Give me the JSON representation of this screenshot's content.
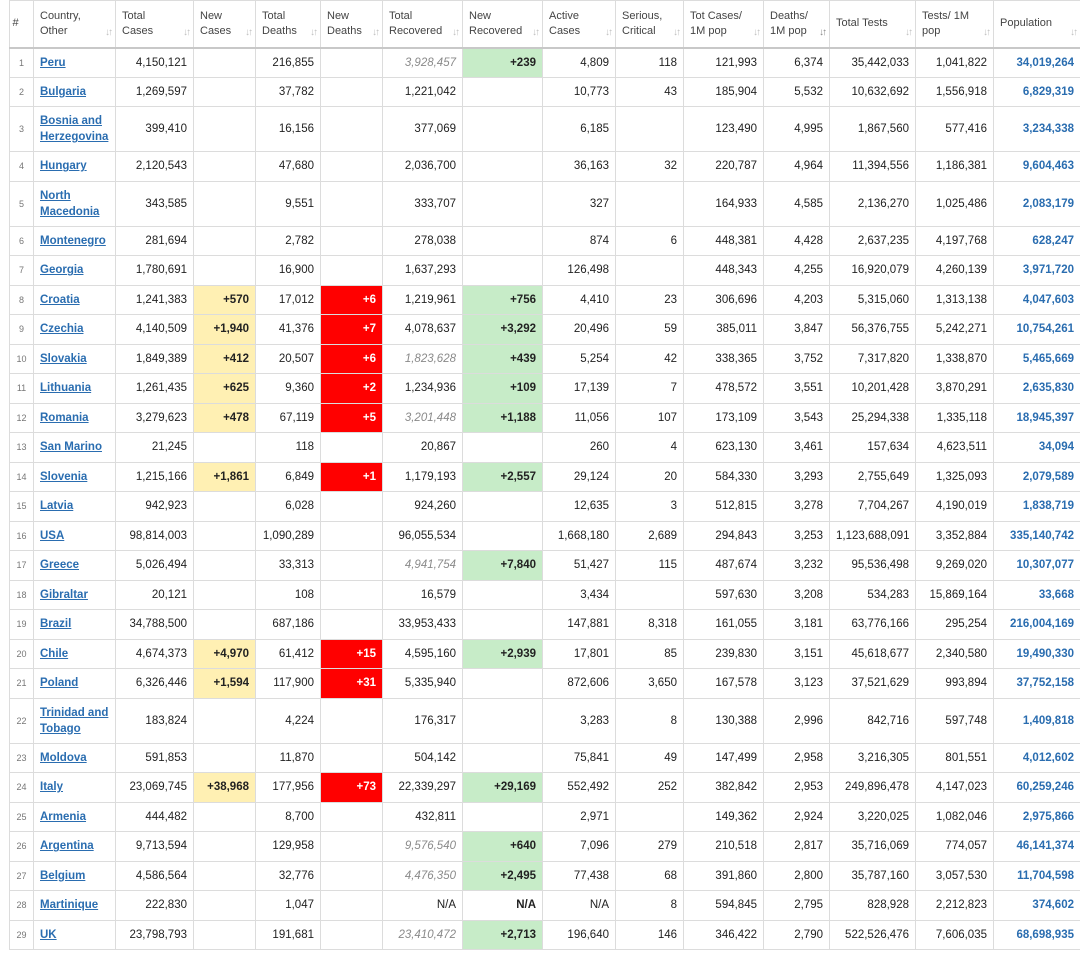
{
  "headers": [
    {
      "key": "num",
      "label": "#"
    },
    {
      "key": "country",
      "label": "Country, Other"
    },
    {
      "key": "total_cases",
      "label": "Total Cases"
    },
    {
      "key": "new_cases",
      "label": "New Cases"
    },
    {
      "key": "total_deaths",
      "label": "Total Deaths"
    },
    {
      "key": "new_deaths",
      "label": "New Deaths"
    },
    {
      "key": "total_recovered",
      "label": "Total Recovered"
    },
    {
      "key": "new_recovered",
      "label": "New Recovered"
    },
    {
      "key": "active_cases",
      "label": "Active Cases"
    },
    {
      "key": "serious_critical",
      "label": "Serious, Critical"
    },
    {
      "key": "tot_cases_1m",
      "label": "Tot Cases/ 1M pop"
    },
    {
      "key": "deaths_1m",
      "label": "Deaths/ 1M pop"
    },
    {
      "key": "total_tests",
      "label": "Total Tests"
    },
    {
      "key": "tests_1m",
      "label": "Tests/ 1M pop"
    },
    {
      "key": "population",
      "label": "Population"
    }
  ],
  "sort_icon": "sort-arrows-icon",
  "active_sort_column": "deaths_1m",
  "colors": {
    "new_cases_bg": "#fff0b3",
    "new_deaths_bg": "#ff0000",
    "new_recovered_bg": "#c7ecc8",
    "link": "#2a6db0",
    "estimated_text": "#8a8a8a"
  },
  "rows": [
    {
      "num": "1",
      "country": "Peru",
      "total_cases": "4,150,121",
      "new_cases": "",
      "total_deaths": "216,855",
      "new_deaths": "",
      "total_recovered": "3,928,457",
      "recovered_estimated": true,
      "new_recovered": "+239",
      "active_cases": "4,809",
      "serious_critical": "118",
      "tot_cases_1m": "121,993",
      "deaths_1m": "6,374",
      "total_tests": "35,442,033",
      "tests_1m": "1,041,822",
      "population": "34,019,264"
    },
    {
      "num": "2",
      "country": "Bulgaria",
      "total_cases": "1,269,597",
      "new_cases": "",
      "total_deaths": "37,782",
      "new_deaths": "",
      "total_recovered": "1,221,042",
      "recovered_estimated": false,
      "new_recovered": "",
      "active_cases": "10,773",
      "serious_critical": "43",
      "tot_cases_1m": "185,904",
      "deaths_1m": "5,532",
      "total_tests": "10,632,692",
      "tests_1m": "1,556,918",
      "population": "6,829,319"
    },
    {
      "num": "3",
      "country": "Bosnia and Herzegovina",
      "total_cases": "399,410",
      "new_cases": "",
      "total_deaths": "16,156",
      "new_deaths": "",
      "total_recovered": "377,069",
      "recovered_estimated": false,
      "new_recovered": "",
      "active_cases": "6,185",
      "serious_critical": "",
      "tot_cases_1m": "123,490",
      "deaths_1m": "4,995",
      "total_tests": "1,867,560",
      "tests_1m": "577,416",
      "population": "3,234,338"
    },
    {
      "num": "4",
      "country": "Hungary",
      "total_cases": "2,120,543",
      "new_cases": "",
      "total_deaths": "47,680",
      "new_deaths": "",
      "total_recovered": "2,036,700",
      "recovered_estimated": false,
      "new_recovered": "",
      "active_cases": "36,163",
      "serious_critical": "32",
      "tot_cases_1m": "220,787",
      "deaths_1m": "4,964",
      "total_tests": "11,394,556",
      "tests_1m": "1,186,381",
      "population": "9,604,463"
    },
    {
      "num": "5",
      "country": "North Macedonia",
      "total_cases": "343,585",
      "new_cases": "",
      "total_deaths": "9,551",
      "new_deaths": "",
      "total_recovered": "333,707",
      "recovered_estimated": false,
      "new_recovered": "",
      "active_cases": "327",
      "serious_critical": "",
      "tot_cases_1m": "164,933",
      "deaths_1m": "4,585",
      "total_tests": "2,136,270",
      "tests_1m": "1,025,486",
      "population": "2,083,179"
    },
    {
      "num": "6",
      "country": "Montenegro",
      "total_cases": "281,694",
      "new_cases": "",
      "total_deaths": "2,782",
      "new_deaths": "",
      "total_recovered": "278,038",
      "recovered_estimated": false,
      "new_recovered": "",
      "active_cases": "874",
      "serious_critical": "6",
      "tot_cases_1m": "448,381",
      "deaths_1m": "4,428",
      "total_tests": "2,637,235",
      "tests_1m": "4,197,768",
      "population": "628,247"
    },
    {
      "num": "7",
      "country": "Georgia",
      "total_cases": "1,780,691",
      "new_cases": "",
      "total_deaths": "16,900",
      "new_deaths": "",
      "total_recovered": "1,637,293",
      "recovered_estimated": false,
      "new_recovered": "",
      "active_cases": "126,498",
      "serious_critical": "",
      "tot_cases_1m": "448,343",
      "deaths_1m": "4,255",
      "total_tests": "16,920,079",
      "tests_1m": "4,260,139",
      "population": "3,971,720"
    },
    {
      "num": "8",
      "country": "Croatia",
      "total_cases": "1,241,383",
      "new_cases": "+570",
      "total_deaths": "17,012",
      "new_deaths": "+6",
      "total_recovered": "1,219,961",
      "recovered_estimated": false,
      "new_recovered": "+756",
      "active_cases": "4,410",
      "serious_critical": "23",
      "tot_cases_1m": "306,696",
      "deaths_1m": "4,203",
      "total_tests": "5,315,060",
      "tests_1m": "1,313,138",
      "population": "4,047,603"
    },
    {
      "num": "9",
      "country": "Czechia",
      "total_cases": "4,140,509",
      "new_cases": "+1,940",
      "total_deaths": "41,376",
      "new_deaths": "+7",
      "total_recovered": "4,078,637",
      "recovered_estimated": false,
      "new_recovered": "+3,292",
      "active_cases": "20,496",
      "serious_critical": "59",
      "tot_cases_1m": "385,011",
      "deaths_1m": "3,847",
      "total_tests": "56,376,755",
      "tests_1m": "5,242,271",
      "population": "10,754,261"
    },
    {
      "num": "10",
      "country": "Slovakia",
      "total_cases": "1,849,389",
      "new_cases": "+412",
      "total_deaths": "20,507",
      "new_deaths": "+6",
      "total_recovered": "1,823,628",
      "recovered_estimated": true,
      "new_recovered": "+439",
      "active_cases": "5,254",
      "serious_critical": "42",
      "tot_cases_1m": "338,365",
      "deaths_1m": "3,752",
      "total_tests": "7,317,820",
      "tests_1m": "1,338,870",
      "population": "5,465,669"
    },
    {
      "num": "11",
      "country": "Lithuania",
      "total_cases": "1,261,435",
      "new_cases": "+625",
      "total_deaths": "9,360",
      "new_deaths": "+2",
      "total_recovered": "1,234,936",
      "recovered_estimated": false,
      "new_recovered": "+109",
      "active_cases": "17,139",
      "serious_critical": "7",
      "tot_cases_1m": "478,572",
      "deaths_1m": "3,551",
      "total_tests": "10,201,428",
      "tests_1m": "3,870,291",
      "population": "2,635,830"
    },
    {
      "num": "12",
      "country": "Romania",
      "total_cases": "3,279,623",
      "new_cases": "+478",
      "total_deaths": "67,119",
      "new_deaths": "+5",
      "total_recovered": "3,201,448",
      "recovered_estimated": true,
      "new_recovered": "+1,188",
      "active_cases": "11,056",
      "serious_critical": "107",
      "tot_cases_1m": "173,109",
      "deaths_1m": "3,543",
      "total_tests": "25,294,338",
      "tests_1m": "1,335,118",
      "population": "18,945,397"
    },
    {
      "num": "13",
      "country": "San Marino",
      "total_cases": "21,245",
      "new_cases": "",
      "total_deaths": "118",
      "new_deaths": "",
      "total_recovered": "20,867",
      "recovered_estimated": false,
      "new_recovered": "",
      "active_cases": "260",
      "serious_critical": "4",
      "tot_cases_1m": "623,130",
      "deaths_1m": "3,461",
      "total_tests": "157,634",
      "tests_1m": "4,623,511",
      "population": "34,094"
    },
    {
      "num": "14",
      "country": "Slovenia",
      "total_cases": "1,215,166",
      "new_cases": "+1,861",
      "total_deaths": "6,849",
      "new_deaths": "+1",
      "total_recovered": "1,179,193",
      "recovered_estimated": false,
      "new_recovered": "+2,557",
      "active_cases": "29,124",
      "serious_critical": "20",
      "tot_cases_1m": "584,330",
      "deaths_1m": "3,293",
      "total_tests": "2,755,649",
      "tests_1m": "1,325,093",
      "population": "2,079,589"
    },
    {
      "num": "15",
      "country": "Latvia",
      "total_cases": "942,923",
      "new_cases": "",
      "total_deaths": "6,028",
      "new_deaths": "",
      "total_recovered": "924,260",
      "recovered_estimated": false,
      "new_recovered": "",
      "active_cases": "12,635",
      "serious_critical": "3",
      "tot_cases_1m": "512,815",
      "deaths_1m": "3,278",
      "total_tests": "7,704,267",
      "tests_1m": "4,190,019",
      "population": "1,838,719"
    },
    {
      "num": "16",
      "country": "USA",
      "total_cases": "98,814,003",
      "new_cases": "",
      "total_deaths": "1,090,289",
      "new_deaths": "",
      "total_recovered": "96,055,534",
      "recovered_estimated": false,
      "new_recovered": "",
      "active_cases": "1,668,180",
      "serious_critical": "2,689",
      "tot_cases_1m": "294,843",
      "deaths_1m": "3,253",
      "total_tests": "1,123,688,091",
      "tests_1m": "3,352,884",
      "population": "335,140,742"
    },
    {
      "num": "17",
      "country": "Greece",
      "total_cases": "5,026,494",
      "new_cases": "",
      "total_deaths": "33,313",
      "new_deaths": "",
      "total_recovered": "4,941,754",
      "recovered_estimated": true,
      "new_recovered": "+7,840",
      "active_cases": "51,427",
      "serious_critical": "115",
      "tot_cases_1m": "487,674",
      "deaths_1m": "3,232",
      "total_tests": "95,536,498",
      "tests_1m": "9,269,020",
      "population": "10,307,077"
    },
    {
      "num": "18",
      "country": "Gibraltar",
      "total_cases": "20,121",
      "new_cases": "",
      "total_deaths": "108",
      "new_deaths": "",
      "total_recovered": "16,579",
      "recovered_estimated": false,
      "new_recovered": "",
      "active_cases": "3,434",
      "serious_critical": "",
      "tot_cases_1m": "597,630",
      "deaths_1m": "3,208",
      "total_tests": "534,283",
      "tests_1m": "15,869,164",
      "population": "33,668"
    },
    {
      "num": "19",
      "country": "Brazil",
      "total_cases": "34,788,500",
      "new_cases": "",
      "total_deaths": "687,186",
      "new_deaths": "",
      "total_recovered": "33,953,433",
      "recovered_estimated": false,
      "new_recovered": "",
      "active_cases": "147,881",
      "serious_critical": "8,318",
      "tot_cases_1m": "161,055",
      "deaths_1m": "3,181",
      "total_tests": "63,776,166",
      "tests_1m": "295,254",
      "population": "216,004,169"
    },
    {
      "num": "20",
      "country": "Chile",
      "total_cases": "4,674,373",
      "new_cases": "+4,970",
      "total_deaths": "61,412",
      "new_deaths": "+15",
      "total_recovered": "4,595,160",
      "recovered_estimated": false,
      "new_recovered": "+2,939",
      "active_cases": "17,801",
      "serious_critical": "85",
      "tot_cases_1m": "239,830",
      "deaths_1m": "3,151",
      "total_tests": "45,618,677",
      "tests_1m": "2,340,580",
      "population": "19,490,330"
    },
    {
      "num": "21",
      "country": "Poland",
      "total_cases": "6,326,446",
      "new_cases": "+1,594",
      "total_deaths": "117,900",
      "new_deaths": "+31",
      "total_recovered": "5,335,940",
      "recovered_estimated": false,
      "new_recovered": "",
      "active_cases": "872,606",
      "serious_critical": "3,650",
      "tot_cases_1m": "167,578",
      "deaths_1m": "3,123",
      "total_tests": "37,521,629",
      "tests_1m": "993,894",
      "population": "37,752,158"
    },
    {
      "num": "22",
      "country": "Trinidad and Tobago",
      "total_cases": "183,824",
      "new_cases": "",
      "total_deaths": "4,224",
      "new_deaths": "",
      "total_recovered": "176,317",
      "recovered_estimated": false,
      "new_recovered": "",
      "active_cases": "3,283",
      "serious_critical": "8",
      "tot_cases_1m": "130,388",
      "deaths_1m": "2,996",
      "total_tests": "842,716",
      "tests_1m": "597,748",
      "population": "1,409,818"
    },
    {
      "num": "23",
      "country": "Moldova",
      "total_cases": "591,853",
      "new_cases": "",
      "total_deaths": "11,870",
      "new_deaths": "",
      "total_recovered": "504,142",
      "recovered_estimated": false,
      "new_recovered": "",
      "active_cases": "75,841",
      "serious_critical": "49",
      "tot_cases_1m": "147,499",
      "deaths_1m": "2,958",
      "total_tests": "3,216,305",
      "tests_1m": "801,551",
      "population": "4,012,602"
    },
    {
      "num": "24",
      "country": "Italy",
      "total_cases": "23,069,745",
      "new_cases": "+38,968",
      "total_deaths": "177,956",
      "new_deaths": "+73",
      "total_recovered": "22,339,297",
      "recovered_estimated": false,
      "new_recovered": "+29,169",
      "active_cases": "552,492",
      "serious_critical": "252",
      "tot_cases_1m": "382,842",
      "deaths_1m": "2,953",
      "total_tests": "249,896,478",
      "tests_1m": "4,147,023",
      "population": "60,259,246"
    },
    {
      "num": "25",
      "country": "Armenia",
      "total_cases": "444,482",
      "new_cases": "",
      "total_deaths": "8,700",
      "new_deaths": "",
      "total_recovered": "432,811",
      "recovered_estimated": false,
      "new_recovered": "",
      "active_cases": "2,971",
      "serious_critical": "",
      "tot_cases_1m": "149,362",
      "deaths_1m": "2,924",
      "total_tests": "3,220,025",
      "tests_1m": "1,082,046",
      "population": "2,975,866"
    },
    {
      "num": "26",
      "country": "Argentina",
      "total_cases": "9,713,594",
      "new_cases": "",
      "total_deaths": "129,958",
      "new_deaths": "",
      "total_recovered": "9,576,540",
      "recovered_estimated": true,
      "new_recovered": "+640",
      "active_cases": "7,096",
      "serious_critical": "279",
      "tot_cases_1m": "210,518",
      "deaths_1m": "2,817",
      "total_tests": "35,716,069",
      "tests_1m": "774,057",
      "population": "46,141,374"
    },
    {
      "num": "27",
      "country": "Belgium",
      "total_cases": "4,586,564",
      "new_cases": "",
      "total_deaths": "32,776",
      "new_deaths": "",
      "total_recovered": "4,476,350",
      "recovered_estimated": true,
      "new_recovered": "+2,495",
      "active_cases": "77,438",
      "serious_critical": "68",
      "tot_cases_1m": "391,860",
      "deaths_1m": "2,800",
      "total_tests": "35,787,160",
      "tests_1m": "3,057,530",
      "population": "11,704,598"
    },
    {
      "num": "28",
      "country": "Martinique",
      "total_cases": "222,830",
      "new_cases": "",
      "total_deaths": "1,047",
      "new_deaths": "",
      "total_recovered": "N/A",
      "recovered_estimated": false,
      "new_recovered": "N/A",
      "active_cases": "N/A",
      "serious_critical": "8",
      "tot_cases_1m": "594,845",
      "deaths_1m": "2,795",
      "total_tests": "828,928",
      "tests_1m": "2,212,823",
      "population": "374,602"
    },
    {
      "num": "29",
      "country": "UK",
      "total_cases": "23,798,793",
      "new_cases": "",
      "total_deaths": "191,681",
      "new_deaths": "",
      "total_recovered": "23,410,472",
      "recovered_estimated": true,
      "new_recovered": "+2,713",
      "active_cases": "196,640",
      "serious_critical": "146",
      "tot_cases_1m": "346,422",
      "deaths_1m": "2,790",
      "total_tests": "522,526,476",
      "tests_1m": "7,606,035",
      "population": "68,698,935"
    }
  ]
}
